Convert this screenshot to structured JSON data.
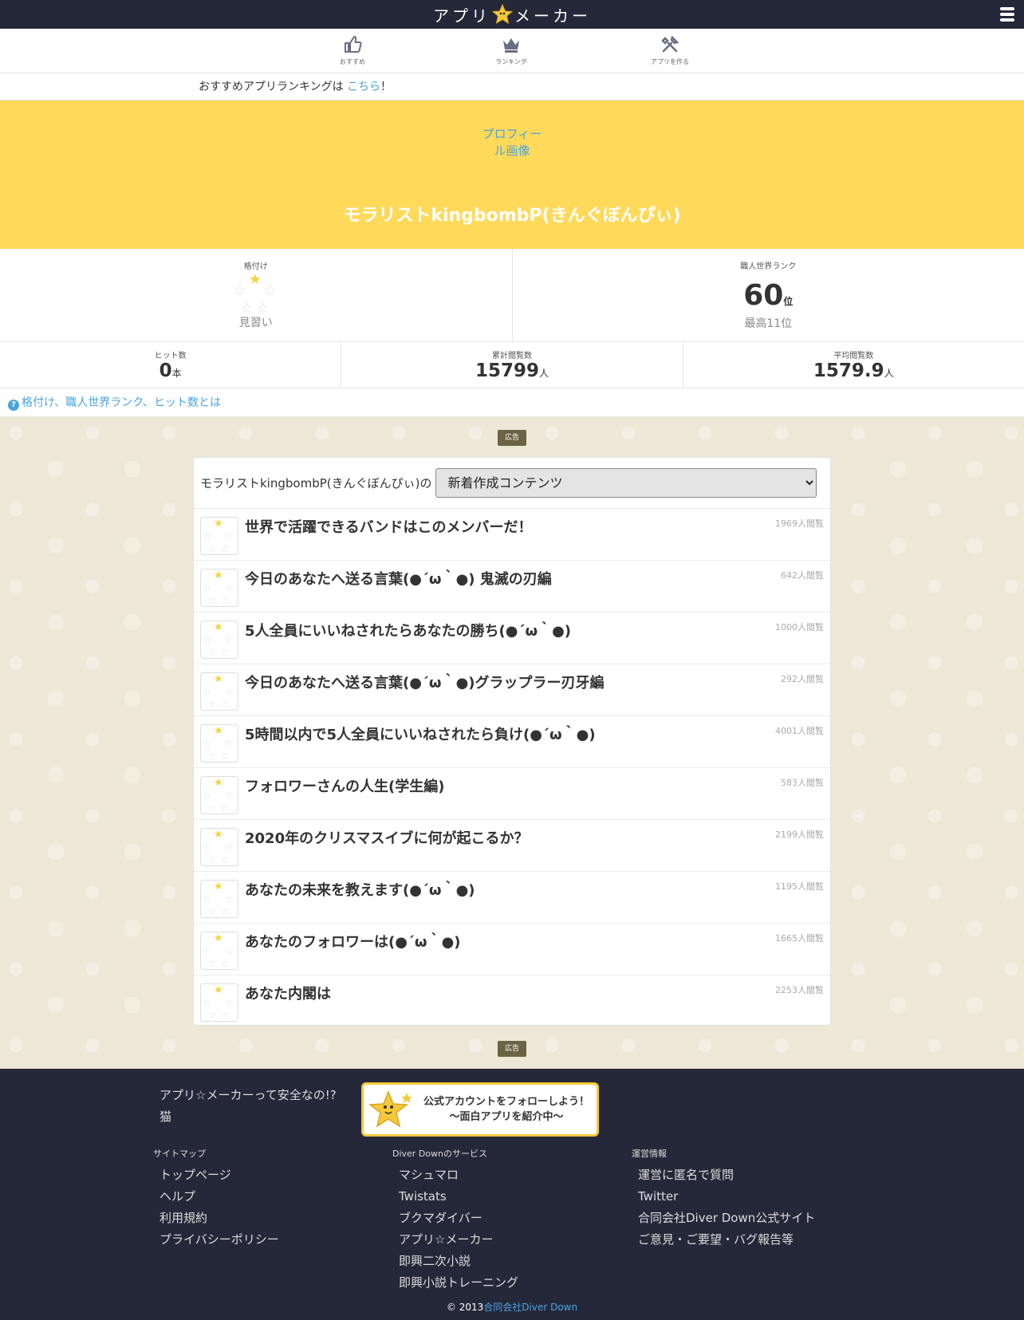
{
  "header": {
    "brand_left": "アプリ",
    "brand_right": "メーカー"
  },
  "nav": [
    {
      "label": "おすすめ",
      "icon": "thumbs-up-icon"
    },
    {
      "label": "ランキング",
      "icon": "crown-icon"
    },
    {
      "label": "アプリを作る",
      "icon": "tools-icon"
    }
  ],
  "notice": {
    "prefix": "おすすめアプリランキングは ",
    "link": "こちら",
    "suffix": "！"
  },
  "profile": {
    "image_alt": "プロフィール画像",
    "name": "モラリストkingbombP(きんぐぼんぴぃ)"
  },
  "stats": {
    "kakuzuke": {
      "caption": "格付け",
      "title": "見習い"
    },
    "world_rank": {
      "caption": "職人世界ランク",
      "value": "60",
      "unit": "位",
      "best": "最高11位"
    },
    "hits": {
      "caption": "ヒット数",
      "value": "0",
      "unit": "本"
    },
    "total_views": {
      "caption": "累計閲覧数",
      "value": "15799",
      "unit": "人"
    },
    "avg_views": {
      "caption": "平均閲覧数",
      "value": "1579.9",
      "unit": "人"
    }
  },
  "help_link": "格付け、職人世界ランク、ヒット数とは",
  "ad_label": "広告",
  "list": {
    "prefix": "モラリストkingbombP(きんぐぼんぴぃ)の",
    "select_value": "新着作成コンテンツ",
    "items": [
      {
        "title": "世界で活躍できるバンドはこのメンバーだ！",
        "views": "1969人閲覧"
      },
      {
        "title": "今日のあなたへ送る言葉(●´ω｀●) 鬼滅の刃編",
        "views": "642人閲覧"
      },
      {
        "title": "5人全員にいいねされたらあなたの勝ち(●´ω｀●)",
        "views": "1000人閲覧"
      },
      {
        "title": "今日のあなたへ送る言葉(●´ω｀●)グラップラー刃牙編",
        "views": "292人閲覧"
      },
      {
        "title": "5時間以内で5人全員にいいねされたら負け(●´ω｀●)",
        "views": "4001人閲覧"
      },
      {
        "title": "フォロワーさんの人生(学生編)",
        "views": "583人閲覧"
      },
      {
        "title": "2020年のクリスマスイブに何が起こるか？",
        "views": "2199人閲覧"
      },
      {
        "title": "あなたの未来を教えます(●´ω｀●)",
        "views": "1195人閲覧"
      },
      {
        "title": "あなたのフォロワーは(●´ω｀●)",
        "views": "1665人閲覧"
      },
      {
        "title": "あなた内閣は",
        "views": "2253人閲覧"
      }
    ]
  },
  "footer": {
    "links_top": [
      "アプリ☆メーカーって安全なの!?",
      "猫"
    ],
    "follow_line1": "公式アカウントをフォローしよう！",
    "follow_line2": "〜面白アプリを紹介中〜",
    "sitemap": {
      "heading": "サイトマップ",
      "links": [
        "トップページ",
        "ヘルプ",
        "利用規約",
        "プライバシーポリシー"
      ]
    },
    "services": {
      "heading": "Diver Downのサービス",
      "links": [
        "マシュマロ",
        "Twistats",
        "ブクマダイバー",
        "アプリ☆メーカー",
        "即興二次小説",
        "即興小説トレーニング"
      ]
    },
    "operation": {
      "heading": "運営情報",
      "links": [
        "運営に匿名で質問",
        "Twitter",
        "合同会社Diver Down公式サイト",
        "ご意見・ご要望・バグ報告等"
      ]
    },
    "copyright_prefix": "© 2013",
    "copyright_link": "合同会社Diver Down"
  },
  "colors": {
    "header_bg": "#252839",
    "hero_bg": "#ffd95a",
    "link": "#4aa3df",
    "star": "#f5d33b"
  }
}
